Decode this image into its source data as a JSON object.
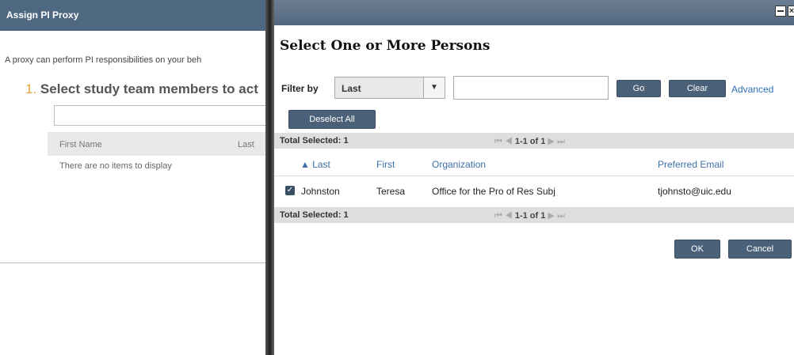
{
  "background_dialog": {
    "title": "Assign PI Proxy",
    "description": "A proxy can perform PI responsibilities on your beh",
    "step_number": "1.",
    "step_label": "Select study team members to act",
    "table_headers": {
      "first": "First Name",
      "last": "Last"
    },
    "empty_message": "There are no items to display"
  },
  "modal": {
    "close_glyph": "×",
    "title": "Select One or More Persons",
    "filter": {
      "label": "Filter by",
      "selected": "Last",
      "arrow_glyph": "▼",
      "input_value": "",
      "go_label": "Go",
      "clear_label": "Clear",
      "advanced_label": "Advanced"
    },
    "deselect_label": "Deselect All",
    "totals_label": "Total Selected: 1",
    "pager": {
      "first": "⏮",
      "prev": "◀",
      "range": "1-1 of 1",
      "next": "▶",
      "last": "⏭"
    },
    "columns": {
      "last": "▲ Last",
      "first": "First",
      "organization": "Organization",
      "email": "Preferred Email"
    },
    "rows": [
      {
        "checked_glyph": "✓",
        "last": "Johnston",
        "first": "Teresa",
        "organization": "Office for the Pro of Res Subj",
        "email": "tjohnsto@uic.edu"
      }
    ],
    "ok_label": "OK",
    "cancel_label": "Cancel"
  },
  "colors": {
    "header_bg": "#4f6882",
    "button_bg": "#4a6179",
    "link": "#2d6fb8",
    "step_number": "#e8a33a"
  }
}
